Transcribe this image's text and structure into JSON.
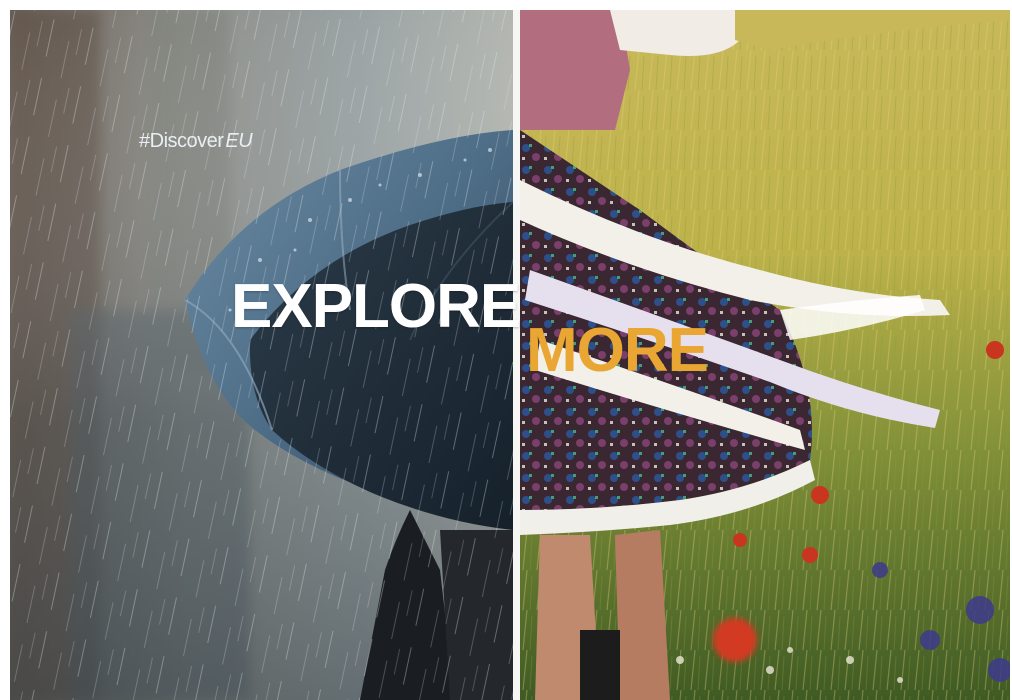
{
  "hashtag": {
    "prefix": "#Discover",
    "suffix": "EU"
  },
  "headline": {
    "left_word": "EXPLORE",
    "right_word": "MORE"
  },
  "colors": {
    "explore_text": "#ffffff",
    "more_text": "#e9a632",
    "divider": "#f6f6f4"
  }
}
